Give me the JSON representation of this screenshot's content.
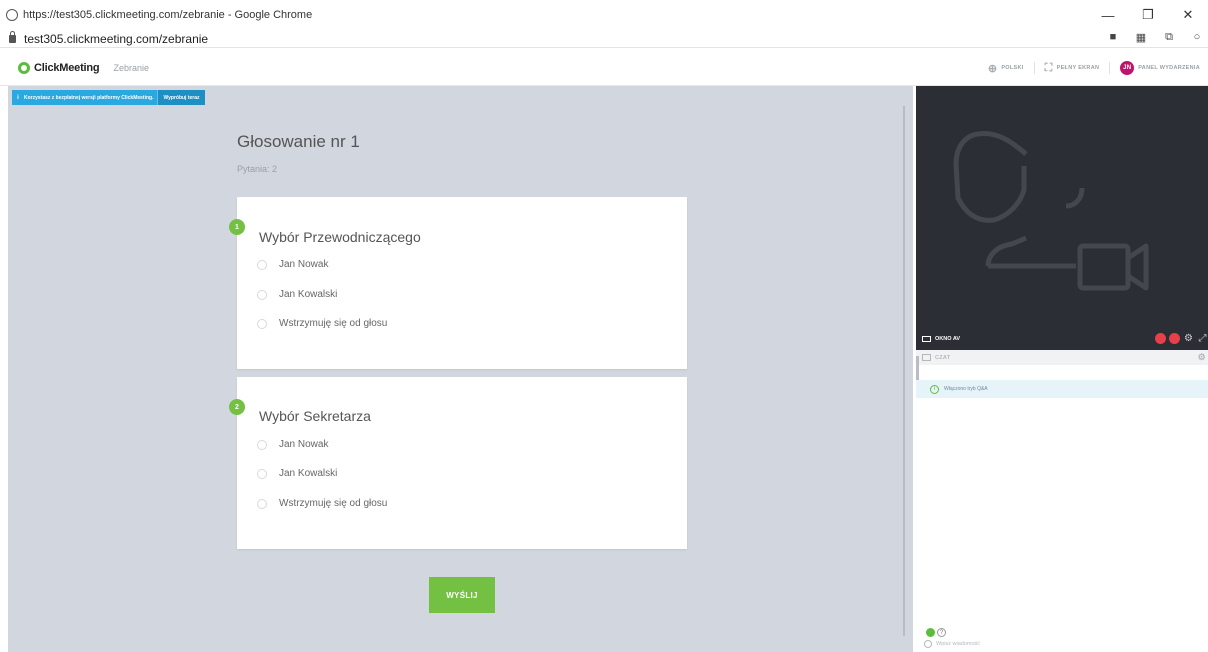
{
  "browser": {
    "window_title": "https://test305.clickmeeting.com/zebranie - Google Chrome",
    "url": "test305.clickmeeting.com/zebranie",
    "controls": {
      "minimize": "—",
      "restore": "❐",
      "close": "✕"
    }
  },
  "header": {
    "brand": "ClickMeeting",
    "room_name": "Zebranie",
    "language_label": "POLSKI",
    "fullscreen_label": "PEŁNY EKRAN",
    "user_initials": "JN",
    "panel_label": "PANEL WYDARZENIA"
  },
  "notice": {
    "text": "Korzystasz z bezpłatnej wersji platformy ClickMeeting.",
    "action": "Wypróbuj teraz"
  },
  "poll": {
    "title": "Głosowanie nr 1",
    "subtitle": "Pytania: 2",
    "questions": [
      {
        "number": "1",
        "question": "Wybór Przewodniczącego",
        "options": [
          "Jan Nowak",
          "Jan Kowalski",
          "Wstrzymuję się od głosu"
        ]
      },
      {
        "number": "2",
        "question": "Wybór Sekretarza",
        "options": [
          "Jan Nowak",
          "Jan Kowalski",
          "Wstrzymuję się od głosu"
        ]
      }
    ],
    "submit_label": "WYŚLIJ"
  },
  "av_window": {
    "label": "OKNO AV"
  },
  "chat": {
    "title": "CZAT",
    "info": "Włączono tryb Q&A",
    "input_placeholder": "Wpisz wiadomość"
  },
  "colors": {
    "accent_green": "#73c043",
    "notice_blue": "#29a9df",
    "avatar": "#c0136b",
    "main_bg": "#d2d6de",
    "video_bg": "#2b2e34"
  }
}
